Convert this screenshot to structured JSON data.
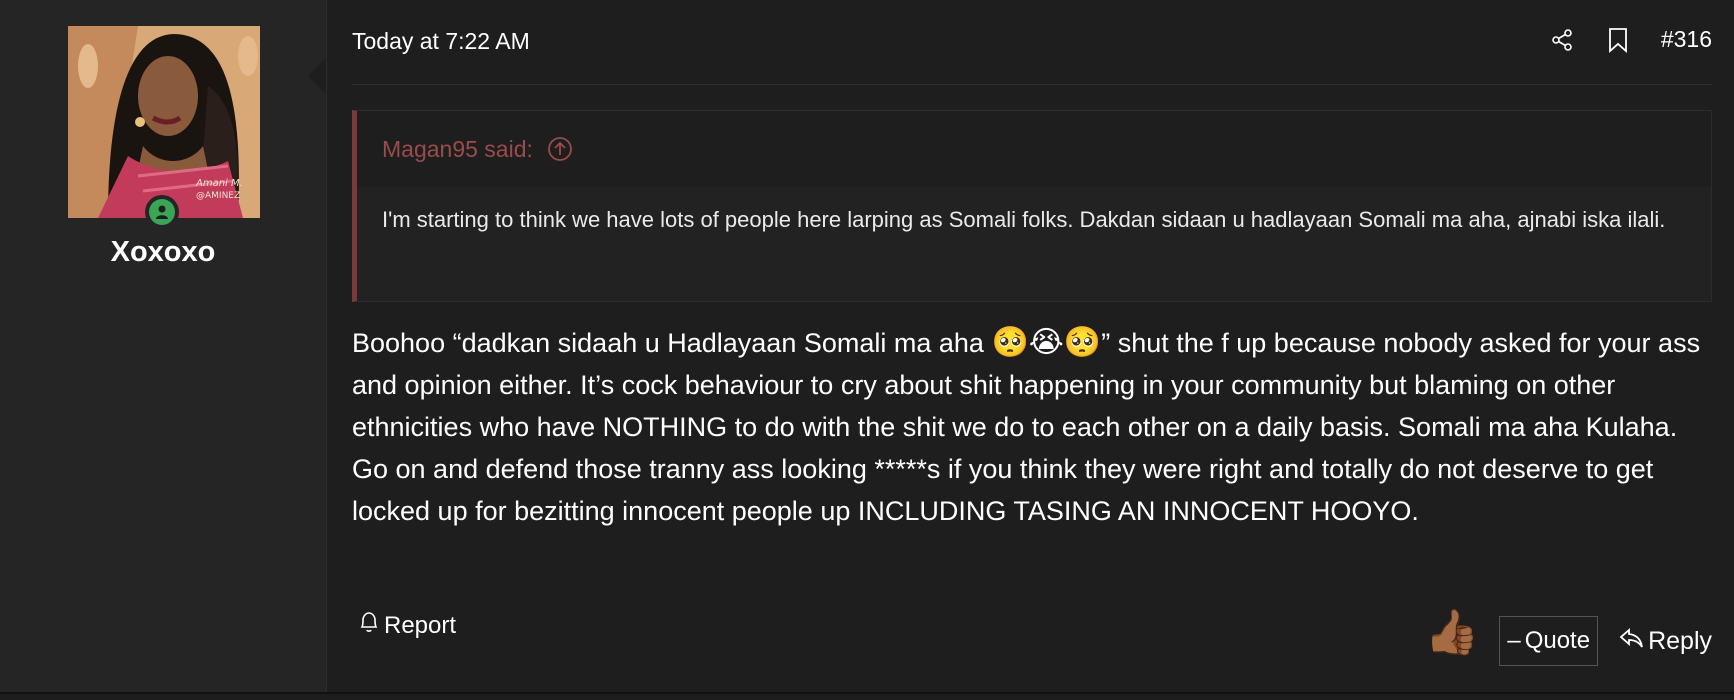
{
  "user": {
    "name": "Xoxoxo",
    "avatar_signature": "Amani M. @AMINEZ",
    "status_color": "#3aa655"
  },
  "post": {
    "timestamp": "Today at 7:22 AM",
    "number": "#316",
    "icons": {
      "share": "share-icon",
      "bookmark": "bookmark-icon"
    }
  },
  "quote": {
    "author_said": "Magan95 said:",
    "text": "I'm starting to think we have lots of people here larping as Somali folks. Dakdan sidaan u hadlayaan Somali ma aha, ajnabi iska ilali."
  },
  "message": {
    "part1": "Boohoo “dadkan sidaah u Hadlayaan Somali ma aha ",
    "emojis": "🥺😭🥺",
    "part2": "” shut the f up because nobody asked for your ass and opinion either. It’s cock behaviour to cry about shit happening in your community but blaming on other ethnicities who have NOTHING to do with the shit we do to each other on a daily basis. Somali ma aha Kulaha. Go on and defend those tranny ass looking *****s if you think they were right and totally do not deserve to get locked up for bezitting innocent people up INCLUDING TASING AN INNOCENT HOOYO."
  },
  "footer": {
    "report_label": "Report",
    "reaction_emoji": "👍🏾",
    "quote_label": "Quote",
    "reply_label": "Reply"
  },
  "colors": {
    "background": "#1e1e1e",
    "sidebar": "#252525",
    "quote_accent": "#7a3a3a",
    "quote_author": "#9a4b4b"
  }
}
